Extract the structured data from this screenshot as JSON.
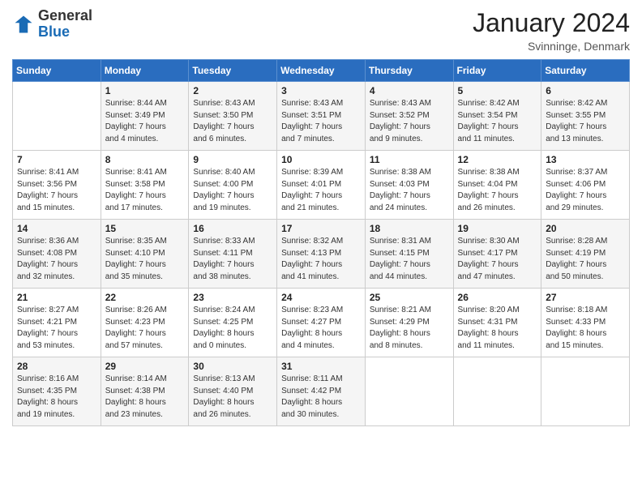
{
  "header": {
    "logo_general": "General",
    "logo_blue": "Blue",
    "month_title": "January 2024",
    "location": "Svinninge, Denmark"
  },
  "days_of_week": [
    "Sunday",
    "Monday",
    "Tuesday",
    "Wednesday",
    "Thursday",
    "Friday",
    "Saturday"
  ],
  "weeks": [
    [
      {
        "day": "",
        "info": ""
      },
      {
        "day": "1",
        "info": "Sunrise: 8:44 AM\nSunset: 3:49 PM\nDaylight: 7 hours\nand 4 minutes."
      },
      {
        "day": "2",
        "info": "Sunrise: 8:43 AM\nSunset: 3:50 PM\nDaylight: 7 hours\nand 6 minutes."
      },
      {
        "day": "3",
        "info": "Sunrise: 8:43 AM\nSunset: 3:51 PM\nDaylight: 7 hours\nand 7 minutes."
      },
      {
        "day": "4",
        "info": "Sunrise: 8:43 AM\nSunset: 3:52 PM\nDaylight: 7 hours\nand 9 minutes."
      },
      {
        "day": "5",
        "info": "Sunrise: 8:42 AM\nSunset: 3:54 PM\nDaylight: 7 hours\nand 11 minutes."
      },
      {
        "day": "6",
        "info": "Sunrise: 8:42 AM\nSunset: 3:55 PM\nDaylight: 7 hours\nand 13 minutes."
      }
    ],
    [
      {
        "day": "7",
        "info": "Sunrise: 8:41 AM\nSunset: 3:56 PM\nDaylight: 7 hours\nand 15 minutes."
      },
      {
        "day": "8",
        "info": "Sunrise: 8:41 AM\nSunset: 3:58 PM\nDaylight: 7 hours\nand 17 minutes."
      },
      {
        "day": "9",
        "info": "Sunrise: 8:40 AM\nSunset: 4:00 PM\nDaylight: 7 hours\nand 19 minutes."
      },
      {
        "day": "10",
        "info": "Sunrise: 8:39 AM\nSunset: 4:01 PM\nDaylight: 7 hours\nand 21 minutes."
      },
      {
        "day": "11",
        "info": "Sunrise: 8:38 AM\nSunset: 4:03 PM\nDaylight: 7 hours\nand 24 minutes."
      },
      {
        "day": "12",
        "info": "Sunrise: 8:38 AM\nSunset: 4:04 PM\nDaylight: 7 hours\nand 26 minutes."
      },
      {
        "day": "13",
        "info": "Sunrise: 8:37 AM\nSunset: 4:06 PM\nDaylight: 7 hours\nand 29 minutes."
      }
    ],
    [
      {
        "day": "14",
        "info": "Sunrise: 8:36 AM\nSunset: 4:08 PM\nDaylight: 7 hours\nand 32 minutes."
      },
      {
        "day": "15",
        "info": "Sunrise: 8:35 AM\nSunset: 4:10 PM\nDaylight: 7 hours\nand 35 minutes."
      },
      {
        "day": "16",
        "info": "Sunrise: 8:33 AM\nSunset: 4:11 PM\nDaylight: 7 hours\nand 38 minutes."
      },
      {
        "day": "17",
        "info": "Sunrise: 8:32 AM\nSunset: 4:13 PM\nDaylight: 7 hours\nand 41 minutes."
      },
      {
        "day": "18",
        "info": "Sunrise: 8:31 AM\nSunset: 4:15 PM\nDaylight: 7 hours\nand 44 minutes."
      },
      {
        "day": "19",
        "info": "Sunrise: 8:30 AM\nSunset: 4:17 PM\nDaylight: 7 hours\nand 47 minutes."
      },
      {
        "day": "20",
        "info": "Sunrise: 8:28 AM\nSunset: 4:19 PM\nDaylight: 7 hours\nand 50 minutes."
      }
    ],
    [
      {
        "day": "21",
        "info": "Sunrise: 8:27 AM\nSunset: 4:21 PM\nDaylight: 7 hours\nand 53 minutes."
      },
      {
        "day": "22",
        "info": "Sunrise: 8:26 AM\nSunset: 4:23 PM\nDaylight: 7 hours\nand 57 minutes."
      },
      {
        "day": "23",
        "info": "Sunrise: 8:24 AM\nSunset: 4:25 PM\nDaylight: 8 hours\nand 0 minutes."
      },
      {
        "day": "24",
        "info": "Sunrise: 8:23 AM\nSunset: 4:27 PM\nDaylight: 8 hours\nand 4 minutes."
      },
      {
        "day": "25",
        "info": "Sunrise: 8:21 AM\nSunset: 4:29 PM\nDaylight: 8 hours\nand 8 minutes."
      },
      {
        "day": "26",
        "info": "Sunrise: 8:20 AM\nSunset: 4:31 PM\nDaylight: 8 hours\nand 11 minutes."
      },
      {
        "day": "27",
        "info": "Sunrise: 8:18 AM\nSunset: 4:33 PM\nDaylight: 8 hours\nand 15 minutes."
      }
    ],
    [
      {
        "day": "28",
        "info": "Sunrise: 8:16 AM\nSunset: 4:35 PM\nDaylight: 8 hours\nand 19 minutes."
      },
      {
        "day": "29",
        "info": "Sunrise: 8:14 AM\nSunset: 4:38 PM\nDaylight: 8 hours\nand 23 minutes."
      },
      {
        "day": "30",
        "info": "Sunrise: 8:13 AM\nSunset: 4:40 PM\nDaylight: 8 hours\nand 26 minutes."
      },
      {
        "day": "31",
        "info": "Sunrise: 8:11 AM\nSunset: 4:42 PM\nDaylight: 8 hours\nand 30 minutes."
      },
      {
        "day": "",
        "info": ""
      },
      {
        "day": "",
        "info": ""
      },
      {
        "day": "",
        "info": ""
      }
    ]
  ]
}
